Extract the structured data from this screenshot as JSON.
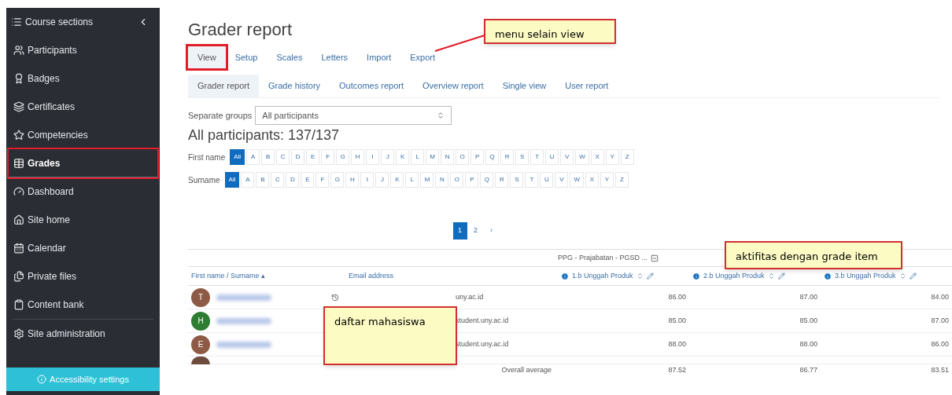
{
  "sidebar": {
    "header": {
      "label": "Course sections"
    },
    "items": [
      {
        "label": "Participants",
        "selected": false,
        "outlined": false
      },
      {
        "label": "Badges",
        "selected": false,
        "outlined": false
      },
      {
        "label": "Certificates",
        "selected": false,
        "outlined": false
      },
      {
        "label": "Competencies",
        "selected": false,
        "outlined": false
      },
      {
        "label": "Grades",
        "selected": true,
        "outlined": true
      },
      {
        "label": "Dashboard",
        "selected": false,
        "outlined": false
      },
      {
        "label": "Site home",
        "selected": false,
        "outlined": false
      },
      {
        "label": "Calendar",
        "selected": false,
        "outlined": false
      },
      {
        "label": "Private files",
        "selected": false,
        "outlined": false
      },
      {
        "label": "Content bank",
        "selected": false,
        "outlined": false
      },
      {
        "label": "Site administration",
        "selected": false,
        "outlined": false
      }
    ],
    "footer_button": "Accessibility settings"
  },
  "page_title": "Grader report",
  "tabs": [
    {
      "label": "View",
      "selected": true,
      "outlined": true
    },
    {
      "label": "Setup",
      "selected": false,
      "outlined": false
    },
    {
      "label": "Scales",
      "selected": false,
      "outlined": false
    },
    {
      "label": "Letters",
      "selected": false,
      "outlined": false
    },
    {
      "label": "Import",
      "selected": false,
      "outlined": false
    },
    {
      "label": "Export",
      "selected": false,
      "outlined": false
    }
  ],
  "subtabs": [
    {
      "label": "Grader report",
      "selected": true
    },
    {
      "label": "Grade history",
      "selected": false
    },
    {
      "label": "Outcomes report",
      "selected": false
    },
    {
      "label": "Overview report",
      "selected": false
    },
    {
      "label": "Single view",
      "selected": false
    },
    {
      "label": "User report",
      "selected": false
    }
  ],
  "group_filter": {
    "label": "Separate groups",
    "value": "All participants"
  },
  "participants_heading": "All participants: 137/137",
  "initial_bars": [
    {
      "label": "First name",
      "letters": [
        {
          "text": "All",
          "selected": true
        },
        {
          "text": "A",
          "selected": false
        },
        {
          "text": "B",
          "selected": false
        },
        {
          "text": "C",
          "selected": false
        },
        {
          "text": "D",
          "selected": false
        },
        {
          "text": "E",
          "selected": false
        },
        {
          "text": "F",
          "selected": false
        },
        {
          "text": "G",
          "selected": false
        },
        {
          "text": "H",
          "selected": false
        },
        {
          "text": "I",
          "selected": false
        },
        {
          "text": "J",
          "selected": false
        },
        {
          "text": "K",
          "selected": false
        },
        {
          "text": "L",
          "selected": false
        },
        {
          "text": "M",
          "selected": false
        },
        {
          "text": "N",
          "selected": false
        },
        {
          "text": "O",
          "selected": false
        },
        {
          "text": "P",
          "selected": false
        },
        {
          "text": "Q",
          "selected": false
        },
        {
          "text": "R",
          "selected": false
        },
        {
          "text": "S",
          "selected": false
        },
        {
          "text": "T",
          "selected": false
        },
        {
          "text": "U",
          "selected": false
        },
        {
          "text": "V",
          "selected": false
        },
        {
          "text": "W",
          "selected": false
        },
        {
          "text": "X",
          "selected": false
        },
        {
          "text": "Y",
          "selected": false
        },
        {
          "text": "Z",
          "selected": false
        }
      ]
    },
    {
      "label": "Surname",
      "letters": [
        {
          "text": "All",
          "selected": true
        },
        {
          "text": "A",
          "selected": false
        },
        {
          "text": "B",
          "selected": false
        },
        {
          "text": "C",
          "selected": false
        },
        {
          "text": "D",
          "selected": false
        },
        {
          "text": "E",
          "selected": false
        },
        {
          "text": "F",
          "selected": false
        },
        {
          "text": "G",
          "selected": false
        },
        {
          "text": "H",
          "selected": false
        },
        {
          "text": "I",
          "selected": false
        },
        {
          "text": "J",
          "selected": false
        },
        {
          "text": "K",
          "selected": false
        },
        {
          "text": "L",
          "selected": false
        },
        {
          "text": "M",
          "selected": false
        },
        {
          "text": "N",
          "selected": false
        },
        {
          "text": "O",
          "selected": false
        },
        {
          "text": "P",
          "selected": false
        },
        {
          "text": "Q",
          "selected": false
        },
        {
          "text": "R",
          "selected": false
        },
        {
          "text": "S",
          "selected": false
        },
        {
          "text": "T",
          "selected": false
        },
        {
          "text": "U",
          "selected": false
        },
        {
          "text": "V",
          "selected": false
        },
        {
          "text": "W",
          "selected": false
        },
        {
          "text": "X",
          "selected": false
        },
        {
          "text": "Y",
          "selected": false
        },
        {
          "text": "Z",
          "selected": false
        }
      ]
    }
  ],
  "pagination": [
    {
      "text": "1",
      "selected": true
    },
    {
      "text": "2",
      "selected": false
    },
    {
      "text": "›",
      "selected": false
    }
  ],
  "table": {
    "category": "PPG - Prajabatan - PGSD ...",
    "sort_indicator": "▴",
    "columns": [
      "First name / Surname",
      "Email address",
      "1.b Unggah Produk",
      "2.b Unggah Produk",
      "3.b Unggah Produk"
    ],
    "rows": [
      {
        "initial": "T",
        "color": "#8d5a45",
        "email": "uny.ac.id",
        "grades": [
          "86.00",
          "87.00",
          "84.00"
        ]
      },
      {
        "initial": "H",
        "color": "#2e7d32",
        "email": "student.uny.ac.id",
        "grades": [
          "85.00",
          "85.00",
          "87.00"
        ]
      },
      {
        "initial": "E",
        "color": "#8d5a45",
        "email": "student.uny.ac.id",
        "grades": [
          "88.00",
          "88.00",
          "86.00"
        ]
      }
    ],
    "average": {
      "label": "Overall average",
      "values": [
        "87.52",
        "86.77",
        "83.51"
      ]
    }
  },
  "annotations": [
    {
      "kind": "menu",
      "text": "menu selain view"
    },
    {
      "kind": "students",
      "text": "daftar mahasiswa"
    },
    {
      "kind": "items",
      "text": "aktifitas dengan grade item"
    }
  ]
}
